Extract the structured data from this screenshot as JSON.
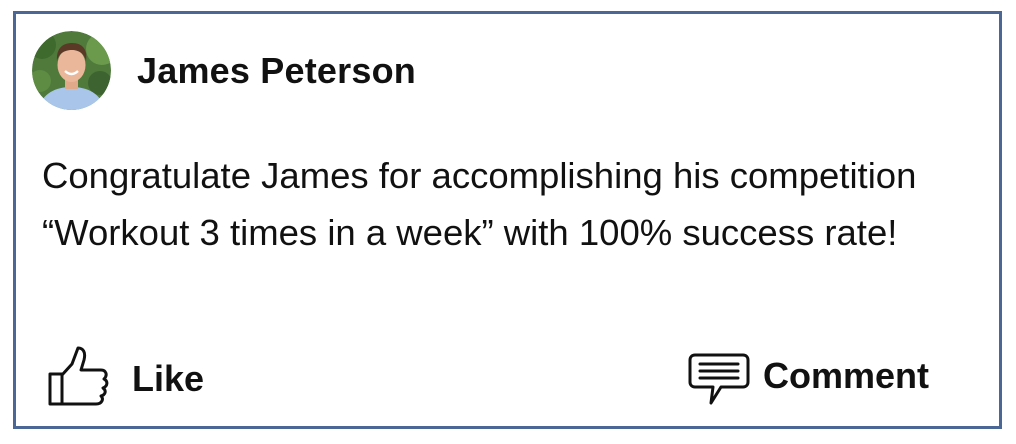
{
  "post": {
    "author": {
      "name": "James Peterson",
      "avatar": "avatar-photo"
    },
    "message": "Congratulate James for accomplishing his competition “Workout 3 times in a week” with 100% success rate!"
  },
  "actions": {
    "like": {
      "label": "Like",
      "icon": "thumbs-up-icon"
    },
    "comment": {
      "label": "Comment",
      "icon": "speech-bubble-icon"
    }
  },
  "colors": {
    "card_border": "#4a6796",
    "text": "#111111"
  }
}
